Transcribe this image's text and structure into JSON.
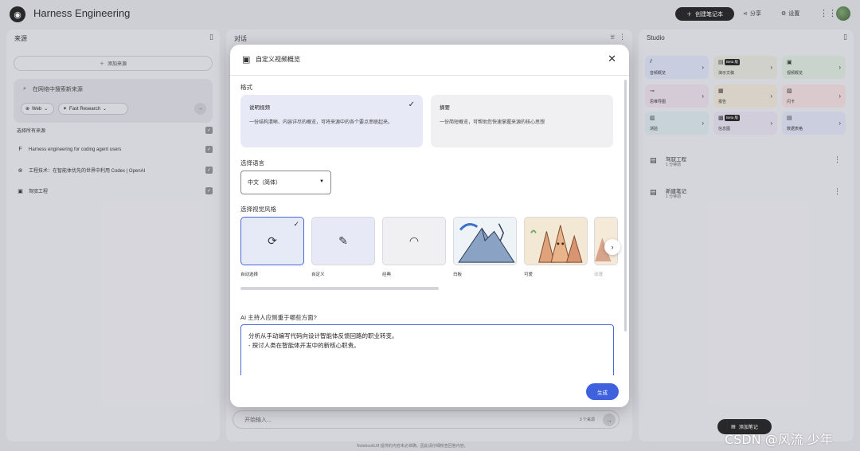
{
  "app": {
    "title": "Harness Engineering",
    "create_notebook": "创建笔记本",
    "share": "分享",
    "settings": "设置"
  },
  "sources_panel": {
    "header": "来源",
    "add_source": "添加来源",
    "search_placeholder": "在网络中搜索新来源",
    "chip_web": "Web",
    "chip_fast": "Fast Research",
    "select_all": "选择所有来源",
    "items": [
      {
        "label": "Harness engineering for coding agent users",
        "icon": "F"
      },
      {
        "label": "工程技术：在智能体优先的世界中利用 Codex | OpenAI",
        "icon": "⊗"
      },
      {
        "label": "驾驭工程",
        "icon": "▣"
      }
    ]
  },
  "chat_panel": {
    "header": "对话",
    "input_placeholder": "开始输入...",
    "source_count": "3 个来源",
    "footer": "NotebookLM 提供的内容未必准确，因此请仔细核查回答内容。"
  },
  "studio_panel": {
    "header": "Studio",
    "cards": [
      {
        "label": "音频概览",
        "color": "#d6dbee",
        "icon": "⫽",
        "beta": false
      },
      {
        "label": "演示文稿",
        "color": "#dfe0d6",
        "icon": "▤",
        "beta": true
      },
      {
        "label": "视频概览",
        "color": "#d6e4d8",
        "icon": "▣",
        "beta": false
      },
      {
        "label": "思维导图",
        "color": "#e4d9e4",
        "icon": "⊸",
        "beta": false
      },
      {
        "label": "报告",
        "color": "#e6e0d2",
        "icon": "▦",
        "beta": false
      },
      {
        "label": "闪卡",
        "color": "#ead8d9",
        "icon": "▨",
        "beta": false
      },
      {
        "label": "测验",
        "color": "#d4e2e6",
        "icon": "▥",
        "beta": false
      },
      {
        "label": "信息图",
        "color": "#e0dbe8",
        "icon": "▩",
        "beta": true
      },
      {
        "label": "数据表格",
        "color": "#d8dcec",
        "icon": "▤",
        "beta": false
      }
    ],
    "beta_label": "Beta 版",
    "notes": [
      {
        "title": "驾驭工程",
        "time": "1 分钟前"
      },
      {
        "title": "新建笔记",
        "time": "1 分钟前"
      }
    ],
    "add_note": "添加笔记"
  },
  "dialog": {
    "title": "自定义视频概览",
    "format_label": "格式",
    "formats": [
      {
        "name": "说明视频",
        "desc": "一份结构清晰、内容详尽的概览，可将来源中的各个要点串联起来。",
        "selected": true
      },
      {
        "name": "摘要",
        "desc": "一份简短概览，可帮助您快速掌握来源的核心思想",
        "selected": false
      }
    ],
    "language_label": "选择语言",
    "language_value": "中文（简体）",
    "style_label": "选择视觉风格",
    "styles": [
      {
        "caption": "自动选择",
        "icon": "auto-icon"
      },
      {
        "caption": "自定义",
        "icon": "pencil-icon"
      },
      {
        "caption": "经典",
        "icon": "classic-icon"
      },
      {
        "caption": "白板",
        "icon": "whiteboard-illustration"
      },
      {
        "caption": "可爱",
        "icon": "kawaii-illustration"
      },
      {
        "caption": "动漫",
        "icon": "anime-illustration"
      }
    ],
    "focus_label": "AI 主持人应侧重于哪些方面?",
    "focus_text": "分析从手动编写代码向设计智能体反馈回路的职业转变。\n- 探讨人类在智能体开发中的新核心职责。",
    "generate": "生成"
  },
  "watermark": "CSDN @风流 少年"
}
